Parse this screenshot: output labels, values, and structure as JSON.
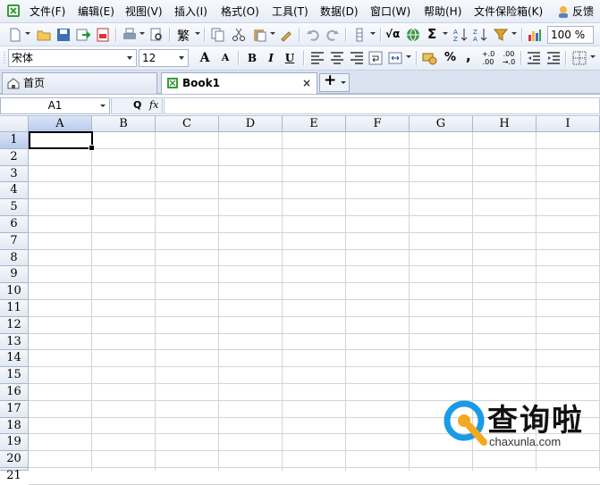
{
  "menubar": {
    "items": [
      "文件(F)",
      "编辑(E)",
      "视图(V)",
      "插入(I)",
      "格式(O)",
      "工具(T)",
      "数据(D)",
      "窗口(W)",
      "帮助(H)",
      "文件保险箱(K)",
      "反馈"
    ]
  },
  "toolbar": {
    "zoom_value": "100 %",
    "sum_symbol": "Σ",
    "percent_label": "%",
    "comma_label": ",",
    "traditional_label": "繁",
    "sqrt_label": "√α"
  },
  "format_toolbar": {
    "font_name": "宋体",
    "font_size": "12",
    "grow_font_label": "A",
    "shrink_font_label": "A",
    "bold_label": "B",
    "italic_label": "I",
    "underline_label": "U",
    "inc_decimal_label": "+.0 .00",
    "dec_decimal_label": ".00 →.0"
  },
  "tabs": [
    {
      "label": "首页",
      "active": false
    },
    {
      "label": "Book1",
      "active": true,
      "close": "×"
    }
  ],
  "add_tab_label": "+",
  "formula_bar": {
    "name_box": "A1",
    "fx_label": "fx",
    "zoom_label": "Q",
    "content": ""
  },
  "sheet": {
    "columns": [
      "A",
      "B",
      "C",
      "D",
      "E",
      "F",
      "G",
      "H",
      "I"
    ],
    "rows": [
      "1",
      "2",
      "3",
      "4",
      "5",
      "6",
      "7",
      "8",
      "9",
      "10",
      "11",
      "12",
      "13",
      "14",
      "15",
      "16",
      "17",
      "18",
      "19",
      "20",
      "21"
    ],
    "active_cell": "A1"
  },
  "watermark": {
    "text": "查询啦",
    "url": "chaxunla.com",
    "accent": "#1a9be6",
    "accent2": "#f4a81d"
  },
  "colors": {
    "menu_bg": "#e6ecf6",
    "header_selected": "#b9cbec",
    "grid_line": "#d4d4d4"
  }
}
